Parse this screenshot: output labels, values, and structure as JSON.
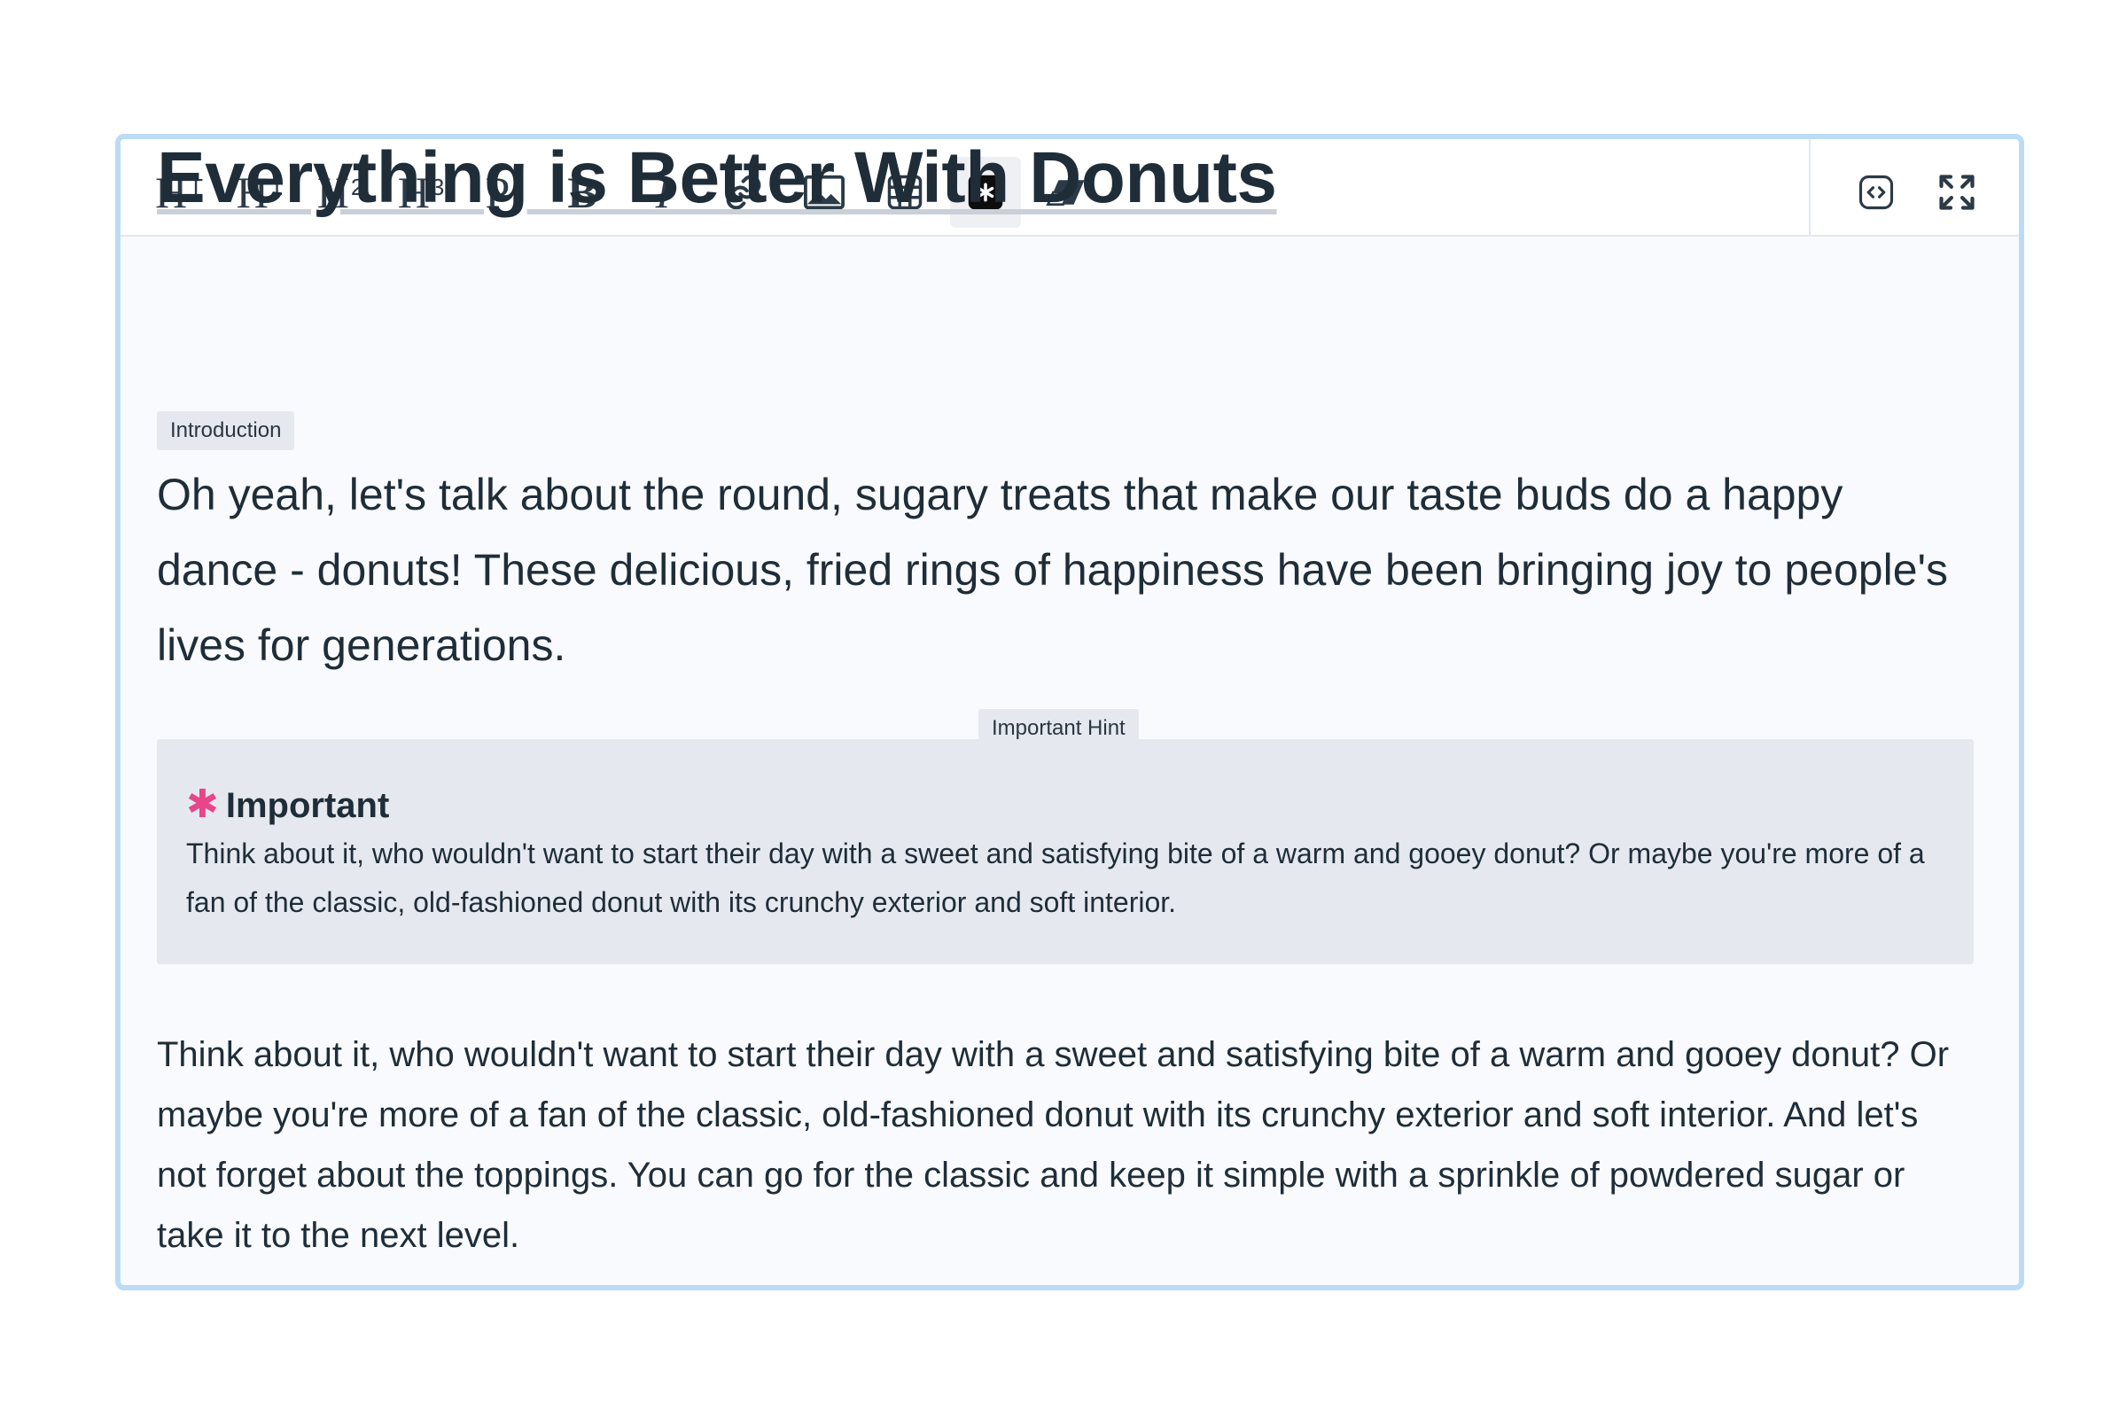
{
  "toolbar": {
    "title_label": "H",
    "title_sup": "T",
    "h1_label": "H",
    "h1_sup": "1",
    "h2_label": "H",
    "h2_sup": "2",
    "h3_label": "H",
    "h3_sup": "3",
    "p_label": "P",
    "p_sup": "I",
    "bold_label": "B",
    "italic_label": "I",
    "icons": [
      "link-icon",
      "image-icon",
      "table-icon",
      "asterisk-callout-icon",
      "eraser-icon",
      "code-view-icon",
      "fullscreen-icon"
    ],
    "active_tool": "asterisk-callout-icon"
  },
  "document": {
    "title": "Everything is Better With Donuts",
    "intro_label": "Introduction",
    "intro_text": "Oh yeah, let's talk about the round, sugary treats that make our taste buds do a happy dance - donuts! These delicious, fried rings of happiness have been bringing joy to people's lives for generations.",
    "hint_label": "Important Hint",
    "callout_icon": "✱",
    "callout_title": "Important",
    "callout_text": "Think about it, who wouldn't want to start their day with a sweet and satisfying bite of a warm and gooey donut? Or maybe you're more of a fan of the classic, old-fashioned donut with its crunchy exterior and soft interior.",
    "body_text": "Think about it, who wouldn't want to start their day with a sweet and satisfying bite of a warm and gooey donut? Or maybe you're more of a fan of the classic, old-fashioned donut with its crunchy exterior and soft interior. And let's not forget about the toppings. You can go for the classic and keep it simple with a sprinkle of powdered sugar or take it to the next level."
  },
  "colors": {
    "editor_border": "#bcdcf6",
    "accent_asterisk": "#e8458b",
    "callout_bg": "#e5e9ef",
    "text": "#1f2d38"
  }
}
